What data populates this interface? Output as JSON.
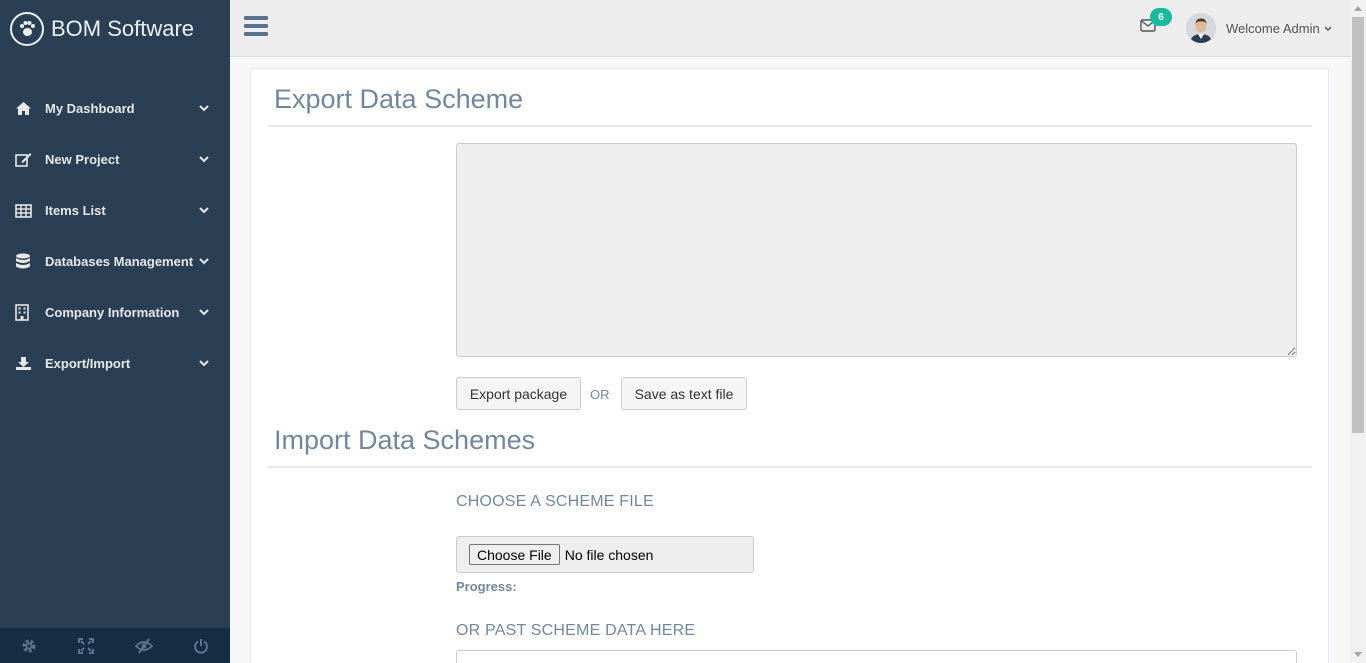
{
  "app": {
    "title": "BOM Software"
  },
  "sidebar": {
    "items": [
      {
        "label": "My Dashboard",
        "icon": "home-icon"
      },
      {
        "label": "New Project",
        "icon": "edit-icon"
      },
      {
        "label": "Items List",
        "icon": "table-icon"
      },
      {
        "label": "Databases Management",
        "icon": "database-icon"
      },
      {
        "label": "Company Information",
        "icon": "building-icon"
      },
      {
        "label": "Export/Import",
        "icon": "download-icon"
      }
    ],
    "footer": [
      "settings-icon",
      "fullscreen-icon",
      "eye-slash-icon",
      "power-icon"
    ]
  },
  "topnav": {
    "mail_count": "6",
    "welcome": "Welcome Admin"
  },
  "export": {
    "title": "Export Data Scheme",
    "textarea_value": "",
    "export_button": "Export package",
    "or_text": "OR",
    "save_button": "Save as text file"
  },
  "import": {
    "title": "Import Data Schemes",
    "choose_label": "CHOOSE A SCHEME FILE",
    "file_button": "Choose File",
    "file_status": "No file chosen",
    "progress_label": "Progress:",
    "paste_label": "OR PAST SCHEME DATA HERE"
  },
  "colors": {
    "sidebar_bg": "#2a3f54",
    "accent_badge": "#1abb9c",
    "heading": "#73879c"
  }
}
